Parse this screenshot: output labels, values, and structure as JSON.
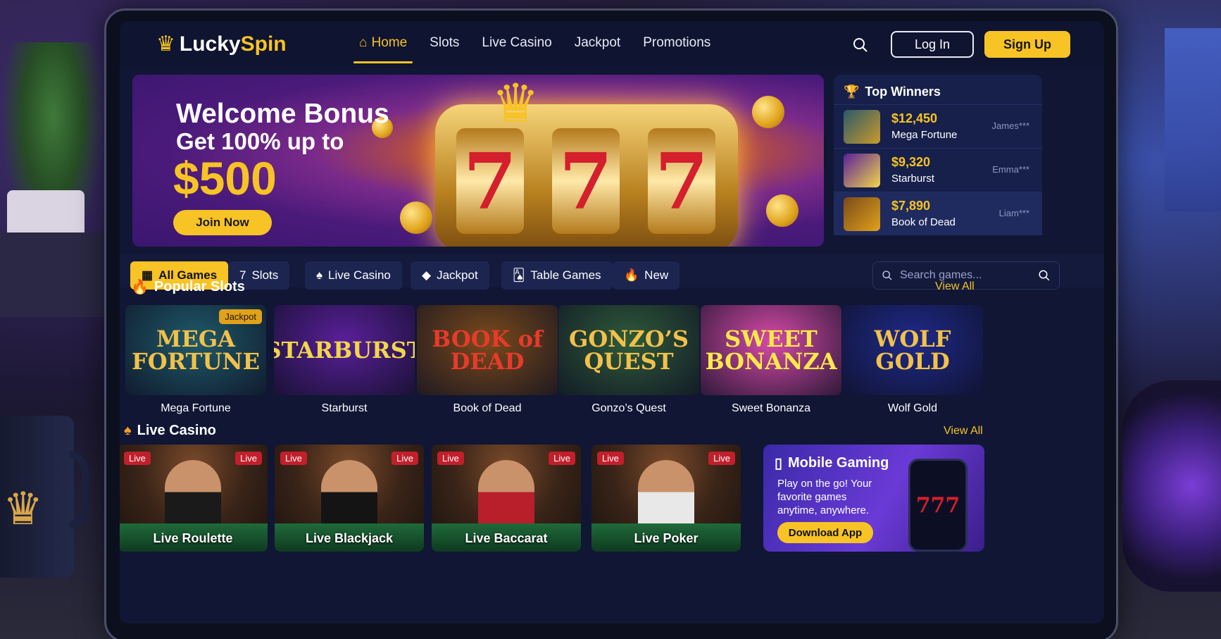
{
  "brand": {
    "crown": "♛",
    "name_a": "Lucky",
    "name_b": "Spin"
  },
  "nav": [
    {
      "label": "Home",
      "icon": "home-icon",
      "active": true
    },
    {
      "label": "Slots"
    },
    {
      "label": "Live Casino"
    },
    {
      "label": "Jackpot"
    },
    {
      "label": "Promotions"
    }
  ],
  "header": {
    "login": "Log In",
    "signup": "Sign Up"
  },
  "hero": {
    "title": "Welcome Bonus",
    "subtitle": "Get 100% up to",
    "amount": "$500",
    "cta": "Join Now",
    "reel_symbol": "7"
  },
  "winners": {
    "title": "Top Winners",
    "items": [
      {
        "amount": "$12,450",
        "game": "Mega Fortune",
        "user": "James***"
      },
      {
        "amount": "$9,320",
        "game": "Starburst",
        "user": "Emma***"
      },
      {
        "amount": "$7,890",
        "game": "Book of Dead",
        "user": "Liam***"
      }
    ]
  },
  "filters": [
    {
      "label": "All Games",
      "icon": "grid-icon",
      "glyph": "▦",
      "active": true
    },
    {
      "label": "Slots",
      "icon": "slot-seven-icon",
      "glyph": "7"
    },
    {
      "label": "Live Casino",
      "icon": "spade-icon",
      "glyph": "♠"
    },
    {
      "label": "Jackpot",
      "icon": "diamond-icon",
      "glyph": "◆"
    },
    {
      "label": "Table Games",
      "icon": "cards-icon",
      "glyph": "🂡"
    },
    {
      "label": "New",
      "icon": "flame-icon",
      "glyph": "🔥"
    }
  ],
  "search": {
    "placeholder": "Search games..."
  },
  "popular": {
    "title": "Popular Slots",
    "view_all": "View All",
    "games": [
      {
        "name": "Mega Fortune",
        "art": "MEGA FORTUNE",
        "badge": "Jackpot",
        "bg": "#1f5a6a",
        "fg": "#f2c14a"
      },
      {
        "name": "Starburst",
        "art": "STARBURST",
        "bg": "#5a1f9a",
        "fg": "#f2d64a"
      },
      {
        "name": "Book of Dead",
        "art": "BOOK of DEAD",
        "bg": "#7a4a1a",
        "fg": "#e83a2a"
      },
      {
        "name": "Gonzo’s Quest",
        "art": "GONZO’S QUEST",
        "bg": "#2f5a3a",
        "fg": "#f2c14a"
      },
      {
        "name": "Sweet Bonanza",
        "art": "SWEET BONANZA",
        "bg": "#d64aa8",
        "fg": "#ffe94a"
      },
      {
        "name": "Wolf Gold",
        "art": "WOLF GOLD",
        "bg": "#1f2a8a",
        "fg": "#f2c14a"
      }
    ]
  },
  "live": {
    "title": "Live Casino",
    "view_all": "View All",
    "tables": [
      {
        "name": "Live Roulette",
        "badge": "Live",
        "dress": "#1a1a1a"
      },
      {
        "name": "Live Blackjack",
        "badge": "Live",
        "dress": "#141414"
      },
      {
        "name": "Live Baccarat",
        "badge": "Live",
        "dress": "#b81f2a"
      },
      {
        "name": "Live Poker",
        "badge": "Live",
        "dress": "#e8e8e8"
      }
    ]
  },
  "promo": {
    "title": "Mobile Gaming",
    "text": "Play on the go! Your favorite games anytime, anywhere.",
    "cta": "Download App",
    "phone_art": "777"
  },
  "colors": {
    "accent": "#f7c325",
    "bg": "#101634",
    "panel": "#17204a"
  }
}
